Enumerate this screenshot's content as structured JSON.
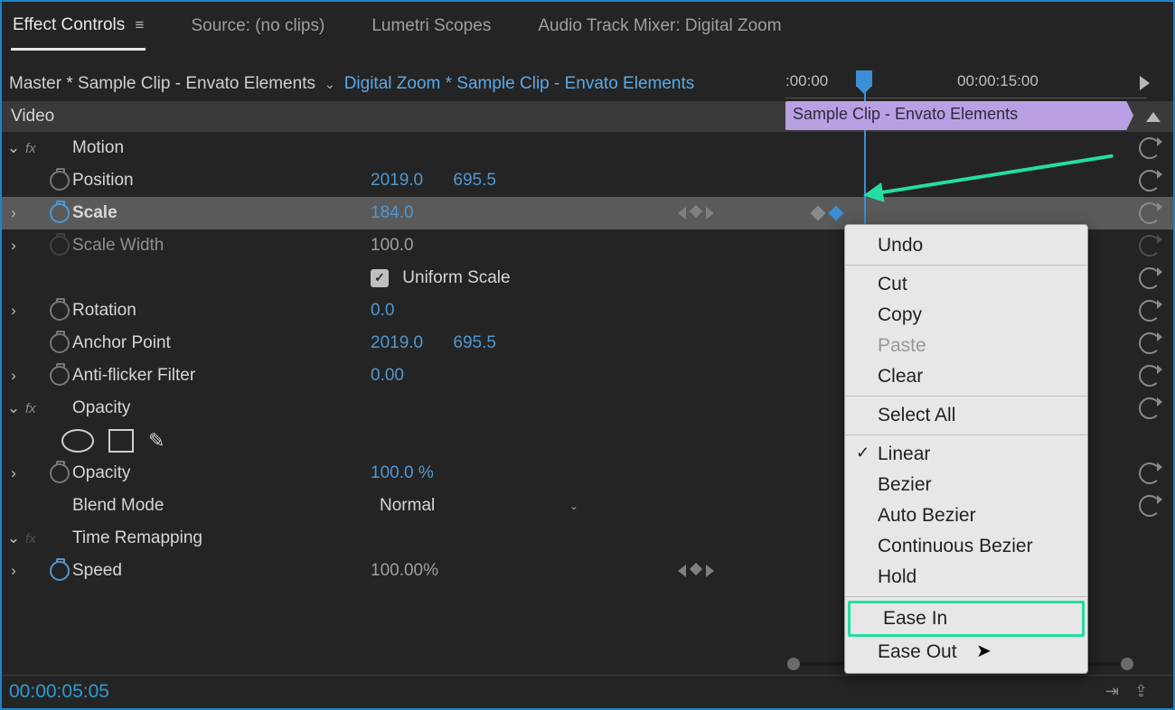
{
  "tabs": {
    "effect_controls": "Effect Controls",
    "source": "Source: (no clips)",
    "lumetri": "Lumetri Scopes",
    "audio_mixer": "Audio Track Mixer: Digital Zoom"
  },
  "breadcrumb": {
    "master": "Master * Sample Clip - Envato Elements",
    "sequence": "Digital Zoom * Sample Clip - Envato Elements"
  },
  "section_header": "Video",
  "motion": {
    "title": "Motion",
    "position_label": "Position",
    "position_x": "2019.0",
    "position_y": "695.5",
    "scale_label": "Scale",
    "scale_value": "184.0",
    "scale_width_label": "Scale Width",
    "scale_width_value": "100.0",
    "uniform_label": "Uniform Scale",
    "rotation_label": "Rotation",
    "rotation_value": "0.0",
    "anchor_label": "Anchor Point",
    "anchor_x": "2019.0",
    "anchor_y": "695.5",
    "anti_label": "Anti-flicker Filter",
    "anti_value": "0.00"
  },
  "opacity": {
    "title": "Opacity",
    "opacity_label": "Opacity",
    "opacity_value": "100.0 %",
    "blend_label": "Blend Mode",
    "blend_value": "Normal"
  },
  "time_remap": {
    "title": "Time Remapping",
    "speed_label": "Speed",
    "speed_value": "100.00%"
  },
  "timeline": {
    "t0": ":00:00",
    "t1": "00:00:15:00",
    "clip_label": "Sample Clip - Envato Elements"
  },
  "context_menu": {
    "undo": "Undo",
    "cut": "Cut",
    "copy": "Copy",
    "paste": "Paste",
    "clear": "Clear",
    "select_all": "Select All",
    "linear": "Linear",
    "bezier": "Bezier",
    "auto_bezier": "Auto Bezier",
    "continuous_bezier": "Continuous Bezier",
    "hold": "Hold",
    "ease_in": "Ease In",
    "ease_out": "Ease Out"
  },
  "footer_time": "00:00:05:05"
}
